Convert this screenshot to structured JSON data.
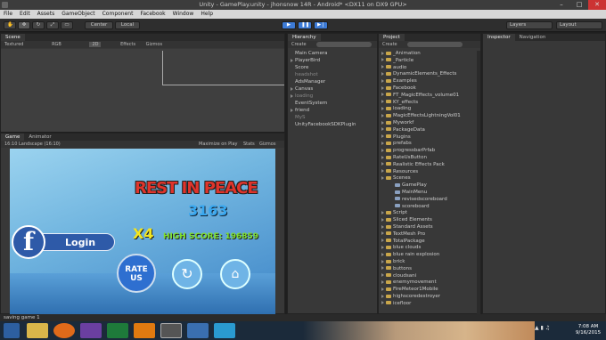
{
  "window": {
    "title": "Unity - GamePlay.unity - jhonsnow 14R - Android* <DX11 on DX9 GPU>"
  },
  "menu": [
    "File",
    "Edit",
    "Assets",
    "GameObject",
    "Component",
    "Facebook",
    "Window",
    "Help"
  ],
  "toolbar": {
    "center": "Center",
    "local": "Local",
    "layers": "Layers",
    "layout": "Layout"
  },
  "scene": {
    "tab": "Scene",
    "textured": "Textured",
    "rgb": "RGB",
    "mode": "2D",
    "effects": "Effects",
    "gizmos": "Gizmos"
  },
  "game": {
    "tab": "Game",
    "animator_tab": "Animator",
    "aspect": "16:10 Landscape (16:10)",
    "maximize": "Maximize on Play",
    "stats": "Stats",
    "gizmos": "Gizmos",
    "rest_in_peace": "REST IN PEACE",
    "score": "3163",
    "multiplier": "X4",
    "high_score": "HIGH SCORE: 196859",
    "login": "Login",
    "rate": "RATE",
    "us": "US"
  },
  "hierarchy": {
    "tab": "Hierarchy",
    "create": "Create",
    "items": [
      {
        "label": "Main Camera",
        "dim": false,
        "arrow": false
      },
      {
        "label": "PlayerBird",
        "dim": false,
        "arrow": true
      },
      {
        "label": "Score",
        "dim": false,
        "arrow": false
      },
      {
        "label": "headshot",
        "dim": true,
        "arrow": false
      },
      {
        "label": "AdsManager",
        "dim": false,
        "arrow": false
      },
      {
        "label": "Canvas",
        "dim": false,
        "arrow": true
      },
      {
        "label": "loading",
        "dim": true,
        "arrow": true
      },
      {
        "label": "EventSystem",
        "dim": false,
        "arrow": false
      },
      {
        "label": "friend",
        "dim": false,
        "arrow": true
      },
      {
        "label": "MyS",
        "dim": true,
        "arrow": false
      },
      {
        "label": "UnityFacebookSDKPlugin",
        "dim": false,
        "arrow": false
      }
    ]
  },
  "project": {
    "tab": "Project",
    "create": "Create",
    "items": [
      {
        "label": "_Animation",
        "indent": 0
      },
      {
        "label": "_Particle",
        "indent": 0
      },
      {
        "label": "audio",
        "indent": 0
      },
      {
        "label": "DynamicElements_Effects",
        "indent": 0
      },
      {
        "label": "Examples",
        "indent": 0
      },
      {
        "label": "Facebook",
        "indent": 0
      },
      {
        "label": "FT_MagicEffects_volume01",
        "indent": 0
      },
      {
        "label": "KY_effects",
        "indent": 0
      },
      {
        "label": "loading",
        "indent": 0
      },
      {
        "label": "MagicEffectsLightningVol01",
        "indent": 0
      },
      {
        "label": "Myworkf",
        "indent": 0
      },
      {
        "label": "PackageData",
        "indent": 0
      },
      {
        "label": "Plugins",
        "indent": 0
      },
      {
        "label": "prefabs",
        "indent": 0
      },
      {
        "label": "progressbarPrfab",
        "indent": 0
      },
      {
        "label": "RateUsButton",
        "indent": 0
      },
      {
        "label": "Realistic Effects Pack",
        "indent": 0
      },
      {
        "label": "Resources",
        "indent": 0
      },
      {
        "label": "Scenes",
        "indent": 0
      },
      {
        "label": "GamePlay",
        "indent": 1
      },
      {
        "label": "MainMenu",
        "indent": 1
      },
      {
        "label": "revisedscoreboard",
        "indent": 1
      },
      {
        "label": "scoreboard",
        "indent": 1
      },
      {
        "label": "Script",
        "indent": 0
      },
      {
        "label": "Sliced Elements",
        "indent": 0
      },
      {
        "label": "Standard Assets",
        "indent": 0
      },
      {
        "label": "TextMesh Pro",
        "indent": 0
      },
      {
        "label": "TotalPackage",
        "indent": 0
      },
      {
        "label": "blue clouds",
        "indent": 0
      },
      {
        "label": "blue rain explosion",
        "indent": 0
      },
      {
        "label": "brick",
        "indent": 0
      },
      {
        "label": "buttons",
        "indent": 0
      },
      {
        "label": "cloudsani",
        "indent": 0
      },
      {
        "label": "enemymovement",
        "indent": 0
      },
      {
        "label": "FireMeteor1Mobile",
        "indent": 0
      },
      {
        "label": "highscoredestroyer",
        "indent": 0
      },
      {
        "label": "icefloor",
        "indent": 0
      }
    ]
  },
  "inspector": {
    "tab": "Inspector",
    "navigation_tab": "Navigation"
  },
  "status": {
    "text": "saving game 1"
  },
  "clock": {
    "time": "7:08 AM",
    "date": "9/16/2015"
  }
}
